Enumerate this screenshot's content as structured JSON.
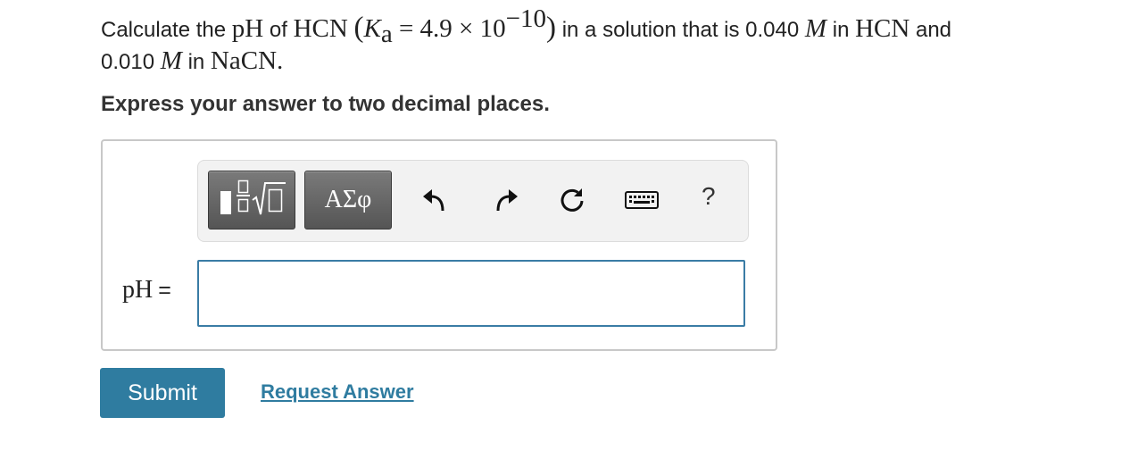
{
  "question": {
    "t1": "Calculate the ",
    "ph": "pH",
    "t2": " of ",
    "hcn": "HCN",
    "K": "K",
    "a": "a",
    "eq_expr": " = 4.9 × 10",
    "exp": "−10",
    "t3": " in a solution that is 0.040 ",
    "M": "M",
    "t4": " in ",
    "hcn2": "HCN",
    "t5": " and",
    "t6": "0.010 ",
    "M2": "M",
    "t7": " in ",
    "nacn": "NaCN",
    "period": "."
  },
  "instruction": "Express your answer to two decimal places.",
  "toolbar": {
    "template_button_icon": "fraction-sqrt-template-icon",
    "greek_label": "ΑΣφ",
    "undo_icon": "undo-icon",
    "redo_icon": "redo-icon",
    "reset_icon": "reset-icon",
    "keyboard_icon": "keyboard-icon",
    "help_label": "?"
  },
  "answer": {
    "label": "pH",
    "equals": "=",
    "value": ""
  },
  "actions": {
    "submit": "Submit",
    "request_answer": "Request Answer"
  },
  "colors": {
    "accent": "#2f7ca0",
    "input_border": "#3a7ca5",
    "toolbar_bg": "#f2f2f2",
    "button_dark": "#555555"
  }
}
